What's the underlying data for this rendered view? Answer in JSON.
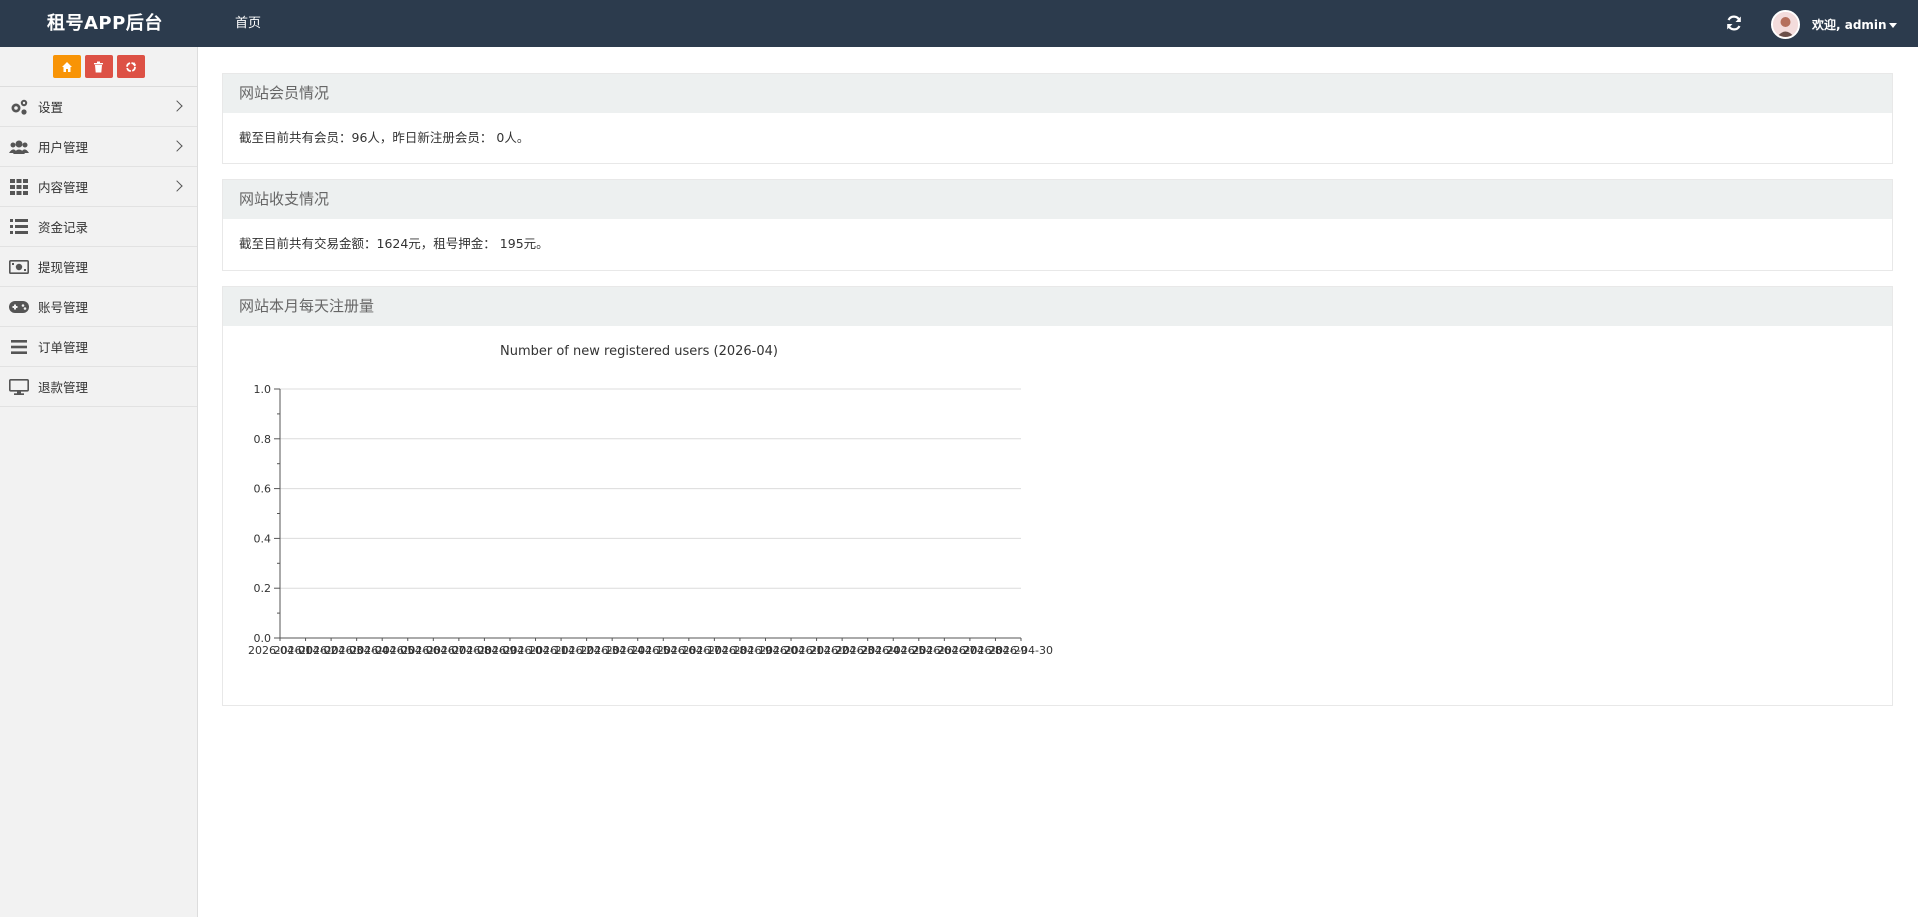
{
  "header": {
    "brand": "租号APP后台",
    "nav_home": "首页",
    "welcome": "欢迎, admin"
  },
  "sidebar": {
    "items": [
      {
        "label": "设置",
        "icon": "gears-icon",
        "has_submenu": true
      },
      {
        "label": "用户管理",
        "icon": "users-icon",
        "has_submenu": true
      },
      {
        "label": "内容管理",
        "icon": "grid-icon",
        "has_submenu": true
      },
      {
        "label": "资金记录",
        "icon": "list-icon",
        "has_submenu": false
      },
      {
        "label": "提现管理",
        "icon": "money-icon",
        "has_submenu": false
      },
      {
        "label": "账号管理",
        "icon": "gamepad-icon",
        "has_submenu": false
      },
      {
        "label": "订单管理",
        "icon": "bars-icon",
        "has_submenu": false
      },
      {
        "label": "退款管理",
        "icon": "desktop-icon",
        "has_submenu": false
      }
    ]
  },
  "panels": {
    "members": {
      "title": "网站会员情况",
      "text": "截至目前共有会员：96人，昨日新注册会员： 0人。"
    },
    "finance": {
      "title": "网站收支情况",
      "text": "截至目前共有交易金额：1624元，租号押金： 195元。"
    },
    "registrations": {
      "title": "网站本月每天注册量"
    }
  },
  "colors": {
    "header_bg": "#2c3b4d",
    "shortcut_orange": "#f89406",
    "shortcut_red": "#dd5145",
    "panel_head_bg": "#edf0f0"
  },
  "chart_data": {
    "type": "line",
    "title": "Number of new registered users (2026-04)",
    "xlabel": "",
    "ylabel": "",
    "ylim": [
      0,
      1
    ],
    "yticks": [
      0.0,
      0.2,
      0.4,
      0.6,
      0.8,
      1.0
    ],
    "grid": true,
    "categories": [
      "2026-04-01",
      "2026-04-02",
      "2026-04-03",
      "2026-04-04",
      "2026-04-05",
      "2026-04-06",
      "2026-04-07",
      "2026-04-08",
      "2026-04-09",
      "2026-04-10",
      "2026-04-11",
      "2026-04-12",
      "2026-04-13",
      "2026-04-14",
      "2026-04-15",
      "2026-04-16",
      "2026-04-17",
      "2026-04-18",
      "2026-04-19",
      "2026-04-20",
      "2026-04-21",
      "2026-04-22",
      "2026-04-23",
      "2026-04-24",
      "2026-04-25",
      "2026-04-26",
      "2026-04-27",
      "2026-04-28",
      "2026-04-29",
      "2026-04-30"
    ],
    "series": [
      {
        "values": []
      }
    ]
  }
}
